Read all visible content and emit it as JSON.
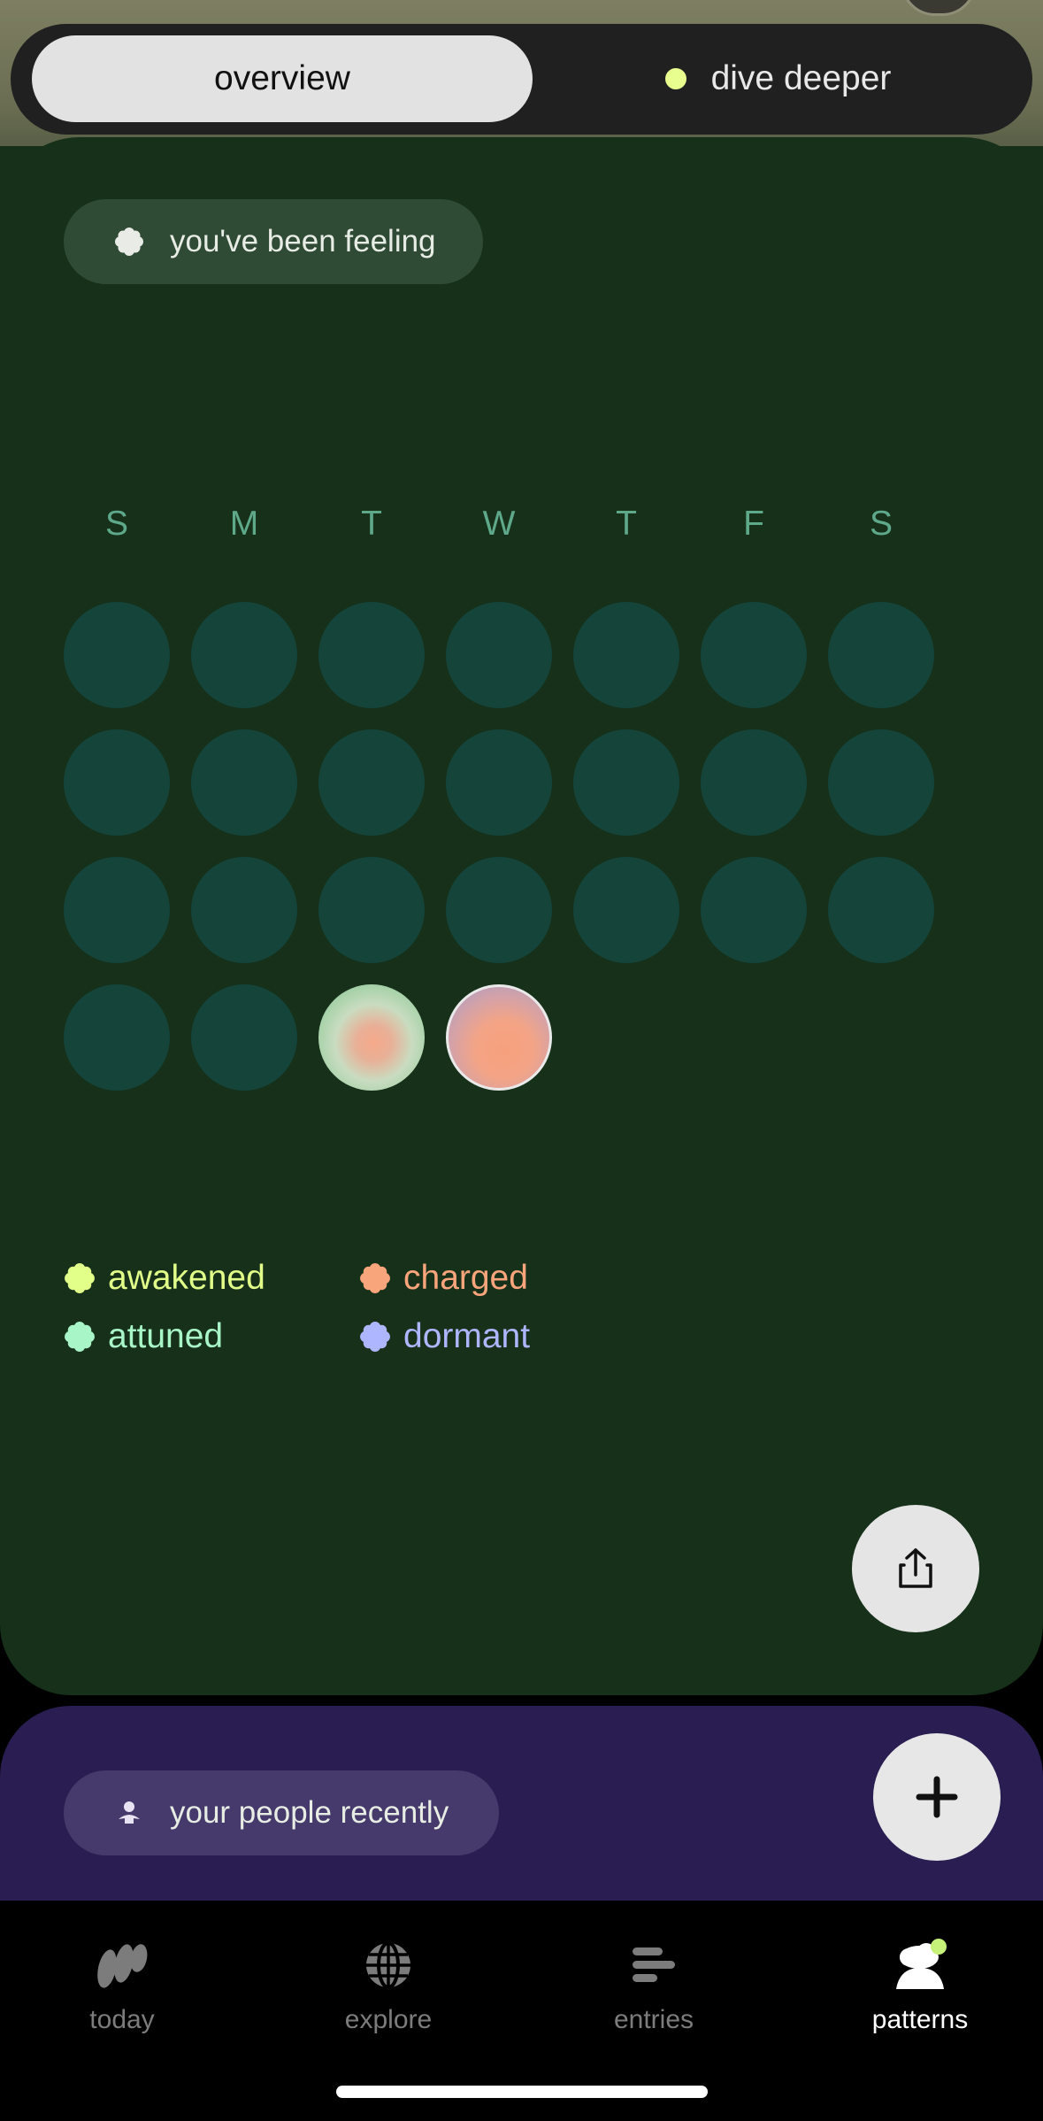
{
  "segmented": {
    "overview_label": "overview",
    "dive_deeper_label": "dive deeper",
    "accent": "#e8ff8f"
  },
  "feeling_card": {
    "title": "you've been feeling",
    "weekdays": [
      "S",
      "M",
      "T",
      "W",
      "T",
      "F",
      "S"
    ],
    "legend": [
      {
        "label": "awakened",
        "color": "#e2ff8a"
      },
      {
        "label": "charged",
        "color": "#f9a57c"
      },
      {
        "label": "attuned",
        "color": "#a8f5c8"
      },
      {
        "label": "dormant",
        "color": "#aeb6ff"
      }
    ],
    "share_icon": "share-icon"
  },
  "people_card": {
    "title": "your people recently"
  },
  "fab": {
    "icon": "plus-icon"
  },
  "tabs": [
    {
      "label": "today",
      "icon": "today-icon"
    },
    {
      "label": "explore",
      "icon": "globe-icon"
    },
    {
      "label": "entries",
      "icon": "entries-icon"
    },
    {
      "label": "patterns",
      "icon": "patterns-icon"
    }
  ]
}
